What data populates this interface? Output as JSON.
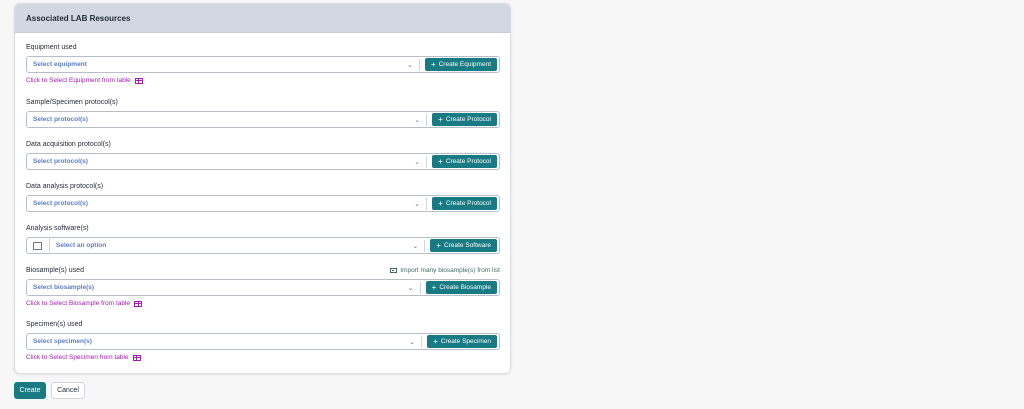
{
  "card": {
    "title": "Associated LAB Resources"
  },
  "fields": {
    "equipment": {
      "label": "Equipment used",
      "placeholder": "Select equipment",
      "create_label": "Create Equipment",
      "table_link": "Click to Select Equipment from table"
    },
    "sample_protocol": {
      "label": "Sample/Specimen protocol(s)",
      "placeholder": "Select protocol(s)",
      "create_label": "Create Protocol"
    },
    "acquisition_protocol": {
      "label": "Data acquisition protocol(s)",
      "placeholder": "Select protocol(s)",
      "create_label": "Create Protocol"
    },
    "analysis_protocol": {
      "label": "Data analysis protocol(s)",
      "placeholder": "Select protocol(s)",
      "create_label": "Create Protocol"
    },
    "software": {
      "label": "Analysis software(s)",
      "placeholder": "Select an option",
      "create_label": "Create Software"
    },
    "biosample": {
      "label": "Biosample(s) used",
      "import_link": "Import many biosample(s) from list",
      "placeholder": "Select biosample(s)",
      "create_label": "Create Biosample",
      "table_link": "Click to Select Biosample from table"
    },
    "specimen": {
      "label": "Specimen(s) used",
      "placeholder": "Select specimen(s)",
      "create_label": "Create Specimen",
      "table_link": "Click to Select Specimen from table"
    }
  },
  "footer": {
    "create_label": "Create",
    "cancel_label": "Cancel"
  },
  "icons": {
    "chevron": "chevron-down-icon",
    "plus": "plus-icon",
    "table": "table-icon",
    "import": "id-card-icon"
  },
  "colors": {
    "accent": "#187a82",
    "link": "#a21caf",
    "placeholder": "#5b7ec2",
    "header_bg": "#d1d8e2"
  }
}
